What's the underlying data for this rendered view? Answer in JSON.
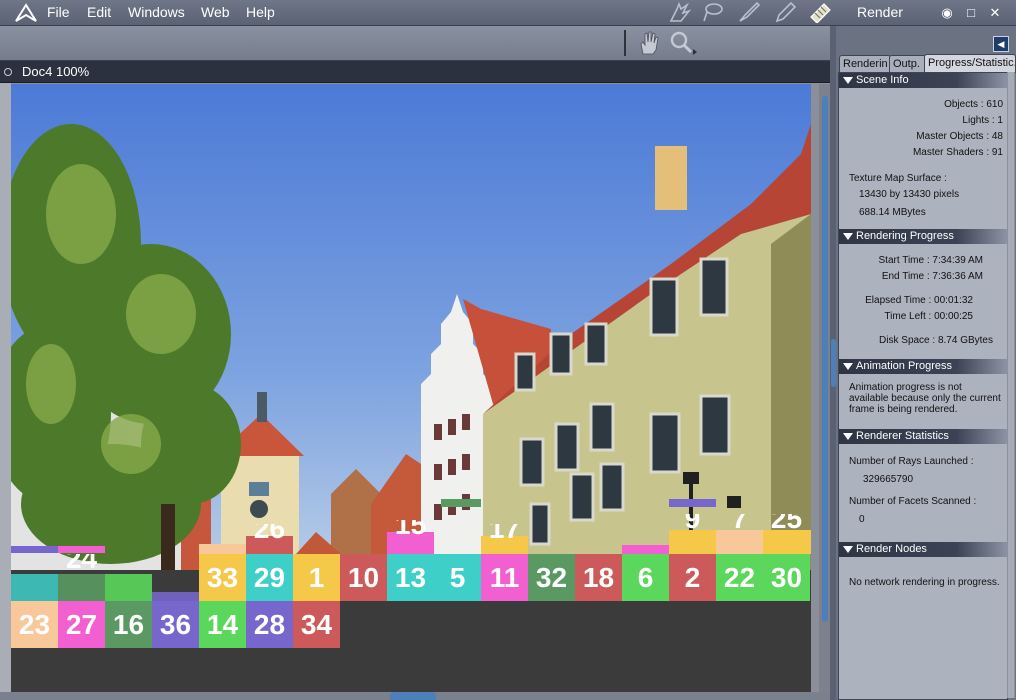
{
  "menubar": {
    "items": [
      "File",
      "Edit",
      "Windows",
      "Web",
      "Help"
    ],
    "tool_icons": [
      "hand-brush-icon",
      "lasso-icon",
      "brush-icon",
      "pen-icon",
      "film-render-icon"
    ],
    "panel_title": "Render"
  },
  "toolbar": {
    "icons": [
      "grab-hand-icon",
      "zoom-icon"
    ]
  },
  "document": {
    "title": "Doc4 100%"
  },
  "render": {
    "bucket_labels_row1": [
      "33",
      "29",
      "1",
      "10",
      "13",
      "5",
      "11",
      "32",
      "18",
      "6",
      "2",
      "22",
      "30"
    ],
    "bucket_labels_row2": [
      "23",
      "27",
      "16",
      "36",
      "14",
      "28",
      "34"
    ],
    "partial_labels": [
      "24",
      "26",
      "15",
      "17",
      "9",
      "7",
      "25"
    ],
    "bucket_colors": [
      "#f5c84a",
      "#3fcfc9",
      "#f25fd0",
      "#5bd85b",
      "#cc5a5a",
      "#7766cc",
      "#f8c79a",
      "#5a9a62"
    ]
  },
  "panel": {
    "tabs": [
      "Renderin",
      "Outp.",
      "Progress/Statistic."
    ],
    "active_tab": 2,
    "scene_info": {
      "heading": "Scene Info",
      "objects": "Objects : 610",
      "lights": "Lights : 1",
      "master_objects": "Master Objects : 48",
      "master_shaders": "Master Shaders : 91",
      "texture_label": "Texture Map Surface :",
      "texture_size": "13430 by 13430 pixels",
      "texture_mb": "688.14 MBytes"
    },
    "rendering_progress": {
      "heading": "Rendering Progress",
      "start_time": "Start Time : 7:34:39 AM",
      "end_time": "End Time : 7:36:36 AM",
      "elapsed": "Elapsed Time : 00:01:32",
      "time_left": "Time Left : 00:00:25",
      "disk_space": "Disk Space : 8.74 GBytes"
    },
    "animation_progress": {
      "heading": "Animation Progress",
      "text": "Animation progress is not available because only the current frame is being rendered."
    },
    "renderer_statistics": {
      "heading": "Renderer Statistics",
      "rays_label": "Number of Rays Launched :",
      "rays_value": "329665790",
      "facets_label": "Number of Facets Scanned :",
      "facets_value": "0"
    },
    "render_nodes": {
      "heading": "Render Nodes",
      "text": "No network rendering in progress."
    }
  }
}
